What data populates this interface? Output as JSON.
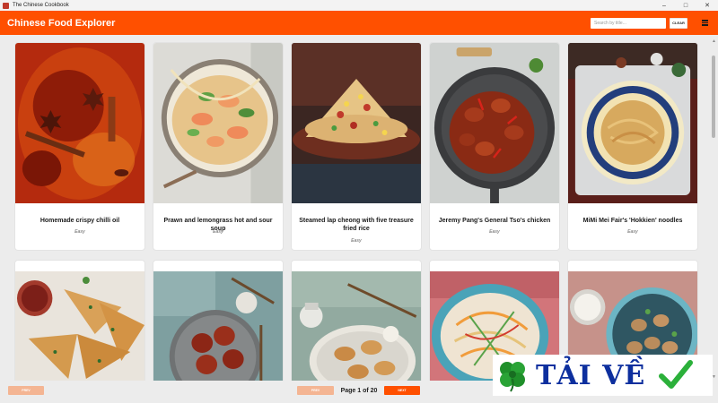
{
  "window": {
    "title": "The Chinese Cookbook",
    "controls": [
      "minimize",
      "maximize",
      "close"
    ]
  },
  "header": {
    "title": "Chinese Food Explorer",
    "search_placeholder": "Search by title...",
    "search_value": "",
    "clear_label": "CLEAR",
    "menu_icon": "hamburger-menu-icon",
    "background_color": "#ff5000"
  },
  "recipes": [
    {
      "name": "Homemade crispy chilli oil",
      "difficulty": "Easy",
      "image": "chilli-oil-photo"
    },
    {
      "name": "Prawn and lemongrass hot and sour soup",
      "difficulty": "Easy",
      "image": "prawn-soup-photo"
    },
    {
      "name": "Steamed lap cheong with five treasure fried rice",
      "difficulty": "Easy",
      "image": "fried-rice-photo"
    },
    {
      "name": "Jeremy Pang's General Tso's chicken",
      "difficulty": "Easy",
      "image": "general-tso-chicken-photo"
    },
    {
      "name": "MiMi Mei Fair's 'Hokkien' noodles",
      "difficulty": "Easy",
      "image": "hokkien-noodles-photo"
    },
    {
      "name": "",
      "difficulty": "",
      "image": "scallion-pancake-photo"
    },
    {
      "name": "",
      "difficulty": "",
      "image": "sticky-chicken-photo"
    },
    {
      "name": "",
      "difficulty": "",
      "image": "dumplings-photo"
    },
    {
      "name": "",
      "difficulty": "",
      "image": "noodle-salad-photo"
    },
    {
      "name": "",
      "difficulty": "",
      "image": "kung-pao-photo"
    }
  ],
  "pagination": {
    "prev_label": "PREV",
    "next_label": "NEXT",
    "page_text": "Page 1 of 20",
    "current_page": 1,
    "total_pages": 20
  },
  "overlay": {
    "logo_text": "TẢI VỀ",
    "icons": [
      "four-leaf-clover-icon",
      "checkmark-icon"
    ]
  }
}
